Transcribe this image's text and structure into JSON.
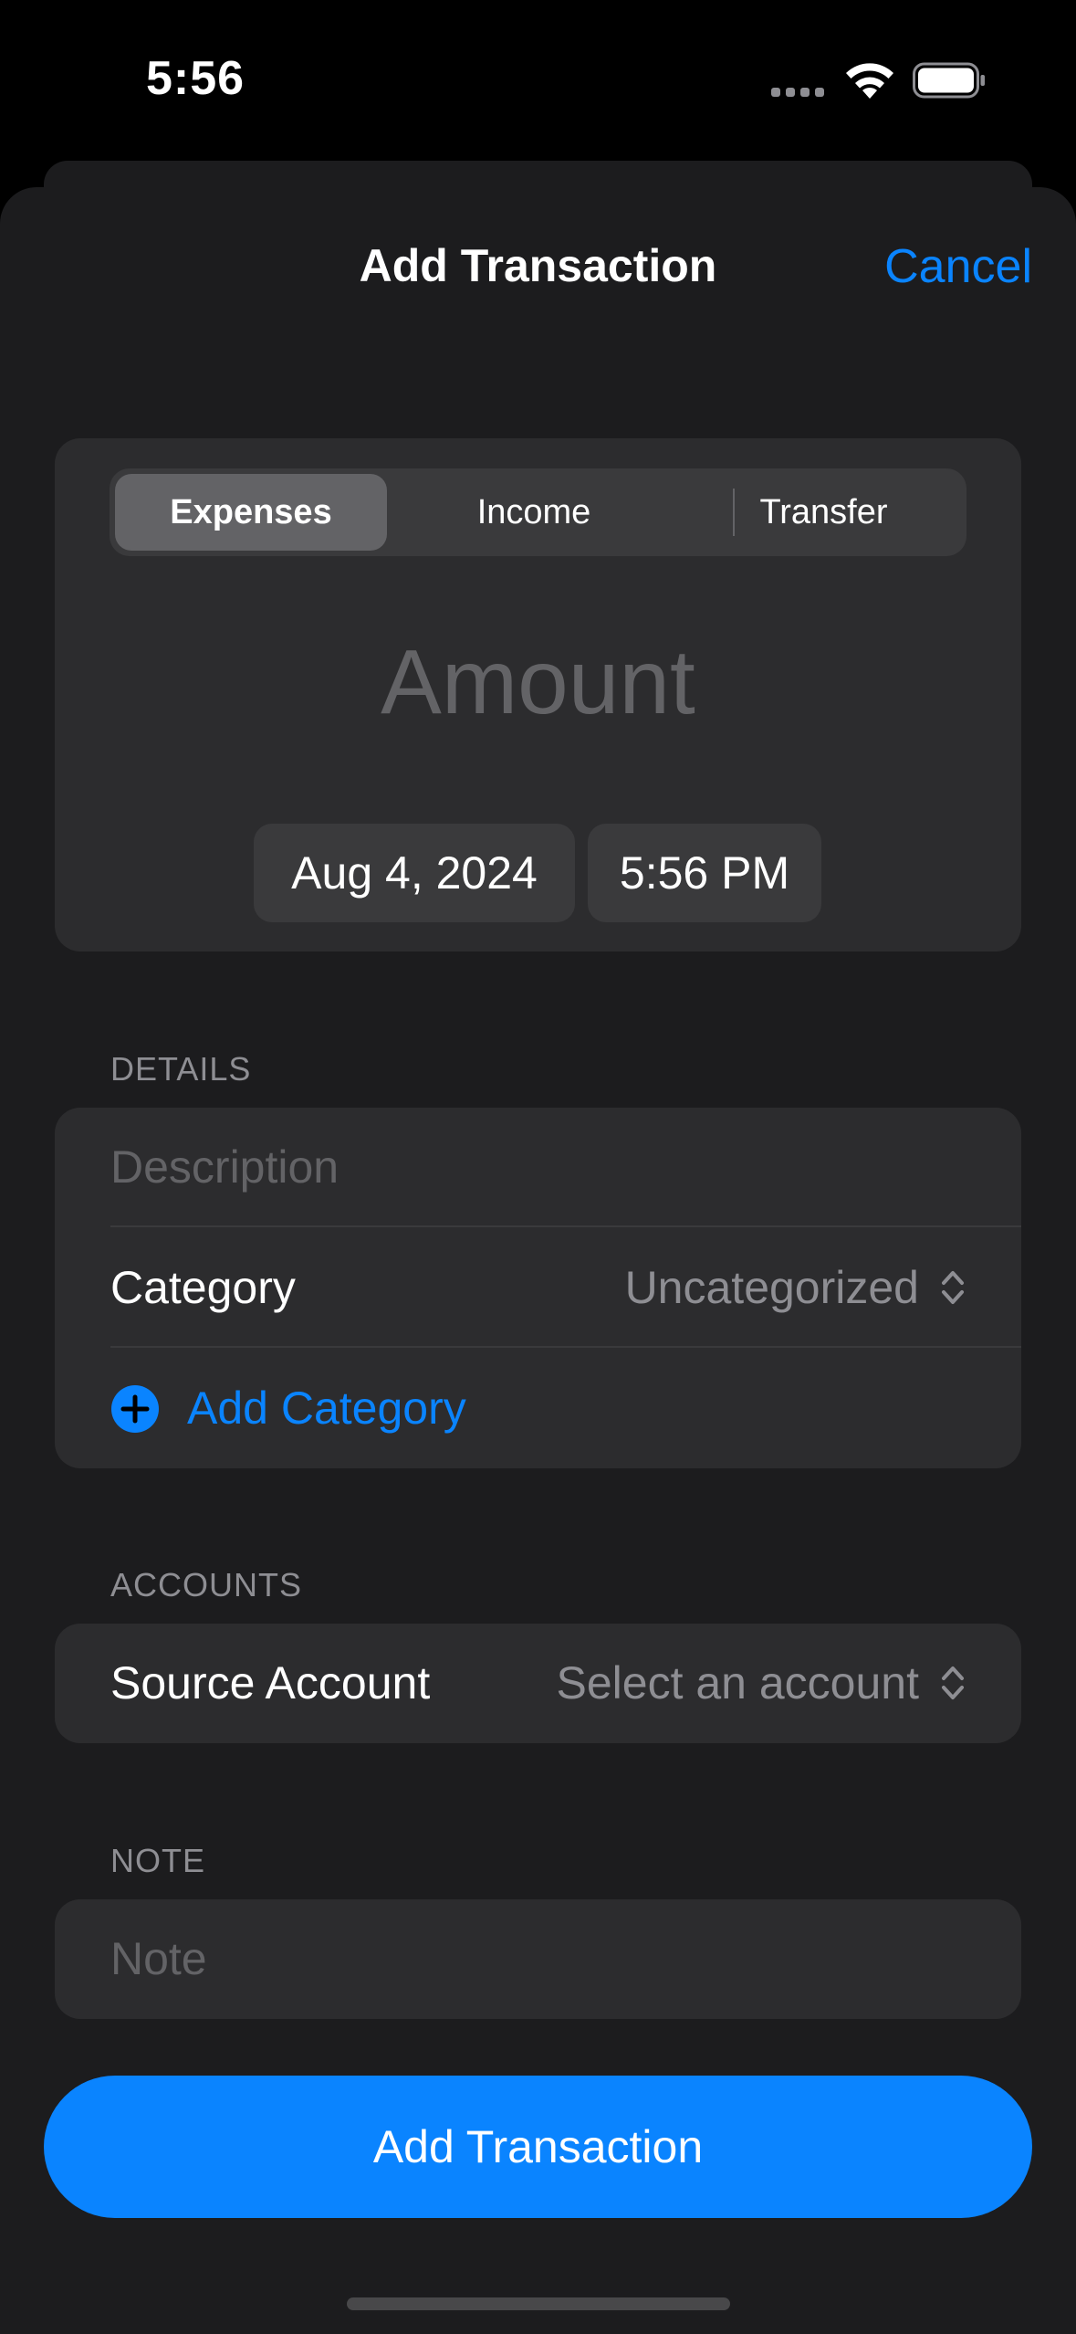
{
  "status_bar": {
    "time": "5:56"
  },
  "nav": {
    "title": "Add Transaction",
    "cancel_label": "Cancel"
  },
  "type_selector": {
    "options": [
      "Expenses",
      "Income",
      "Transfer"
    ],
    "selected": "Expenses"
  },
  "amount": {
    "placeholder": "Amount"
  },
  "datetime": {
    "date": "Aug 4, 2024",
    "time": "5:56 PM"
  },
  "details": {
    "header": "DETAILS",
    "description_placeholder": "Description",
    "category_label": "Category",
    "category_value": "Uncategorized",
    "add_category_label": "Add Category"
  },
  "accounts": {
    "header": "ACCOUNTS",
    "source_label": "Source Account",
    "source_value": "Select an account"
  },
  "note": {
    "header": "NOTE",
    "placeholder": "Note"
  },
  "primary_button_label": "Add Transaction",
  "colors": {
    "accent": "#0a84ff",
    "background": "#1c1c1e",
    "card": "#2c2c2e",
    "secondary_text": "#8e8e93"
  },
  "icons": [
    "cellular-signal-icon",
    "wifi-icon",
    "battery-icon",
    "chevron-updown-icon",
    "plus-circle-icon"
  ]
}
